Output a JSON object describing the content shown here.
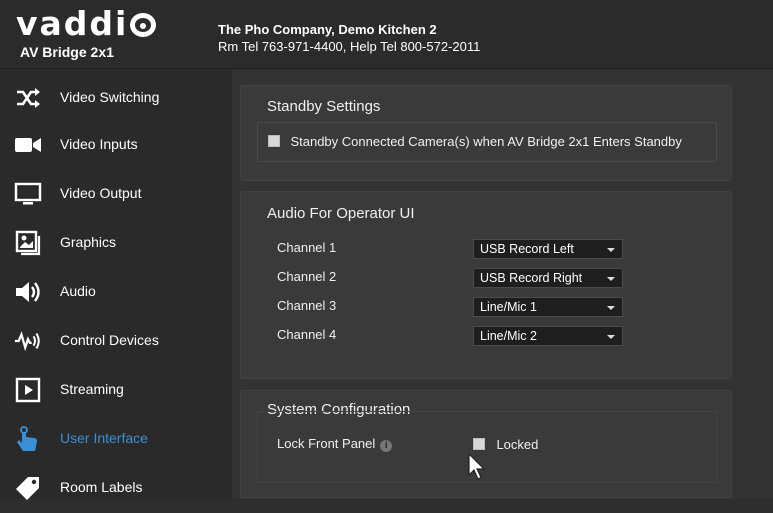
{
  "header": {
    "logo_text": "vaddio",
    "product_name": "AV Bridge 2x1",
    "site_name": "The Pho Company, Demo Kitchen 2",
    "site_contact": "Rm Tel 763-971-4400, Help Tel 800-572-2011"
  },
  "sidebar": {
    "items": [
      {
        "label": "Video Switching",
        "icon": "switch-arrows-icon"
      },
      {
        "label": "Video Inputs",
        "icon": "video-camera-icon"
      },
      {
        "label": "Video Output",
        "icon": "monitor-icon"
      },
      {
        "label": "Graphics",
        "icon": "graphics-icon"
      },
      {
        "label": "Audio",
        "icon": "speaker-icon"
      },
      {
        "label": "Control Devices",
        "icon": "control-signal-icon"
      },
      {
        "label": "Streaming",
        "icon": "play-icon"
      },
      {
        "label": "User Interface",
        "icon": "touch-hand-icon",
        "active": true
      },
      {
        "label": "Room Labels",
        "icon": "tag-icon"
      }
    ]
  },
  "standby": {
    "title": "Standby Settings",
    "checkbox_label": "Standby Connected Camera(s) when AV Bridge 2x1 Enters Standby"
  },
  "audio": {
    "title": "Audio For Operator UI",
    "channels": [
      {
        "label": "Channel 1",
        "value": "USB Record Left"
      },
      {
        "label": "Channel 2",
        "value": "USB Record Right"
      },
      {
        "label": "Channel 3",
        "value": "Line/Mic 1"
      },
      {
        "label": "Channel 4",
        "value": "Line/Mic 2"
      }
    ]
  },
  "system": {
    "title": "System Configuration",
    "lock_label": "Lock Front Panel",
    "info_glyph": "i",
    "locked_label": "Locked"
  },
  "colors": {
    "accent": "#3b8fd6",
    "background": "#2e2e2e"
  }
}
